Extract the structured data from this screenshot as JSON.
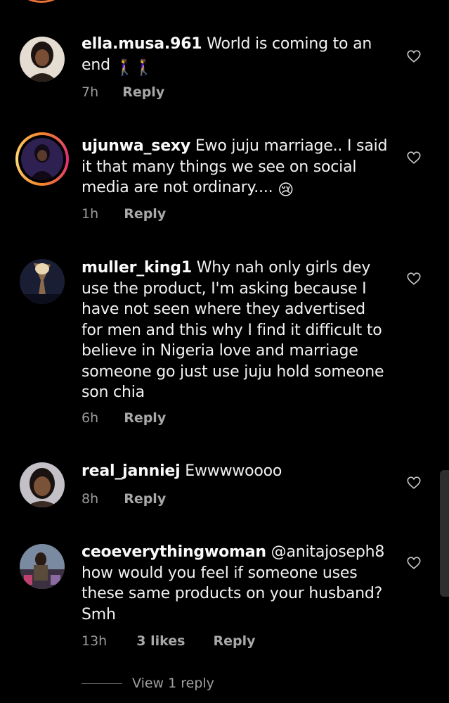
{
  "comments": [
    {
      "username": "ella.musa.961",
      "text": " World is coming to an end ",
      "emoji": "🚶‍♀️🚶‍♀️",
      "time": "7h",
      "likes": "",
      "reply": "Reply",
      "avatar_color": "#d9d0c4"
    },
    {
      "username": "ujunwa_sexy",
      "text": " Ewo juju marriage.. I said it that many things we see on social media are not ordinary.... ",
      "emoji": "😢",
      "time": "1h",
      "likes": "",
      "reply": "Reply",
      "avatar_color": "#3a2a5a",
      "has_story": true
    },
    {
      "username": "muller_king1",
      "text": " Why nah only girls dey use the product, I'm asking because I have not seen where they advertised for men and this why I find it difficult to believe in Nigeria love and marriage someone go just use juju hold someone son chia",
      "emoji": "",
      "time": "6h",
      "likes": "",
      "reply": "Reply",
      "avatar_color": "#2a2f4a"
    },
    {
      "username": "real_janniej",
      "text": " Ewwwwoooo",
      "emoji": "",
      "time": "8h",
      "likes": "",
      "reply": "Reply",
      "avatar_color": "#b8b4bc"
    },
    {
      "username": "ceoeverythingwoman",
      "text": " @anitajoseph8 how would you feel if someone uses these same products on your husband? Smh",
      "emoji": "",
      "time": "13h",
      "likes": "3 likes",
      "reply": "Reply",
      "avatar_color": "#6a7a8a"
    }
  ],
  "view_replies": "View 1 reply",
  "colors": {
    "background": "#000000",
    "text": "#f2f2f2",
    "meta": "#9a9a9a",
    "story_ring": "#e8703a"
  }
}
